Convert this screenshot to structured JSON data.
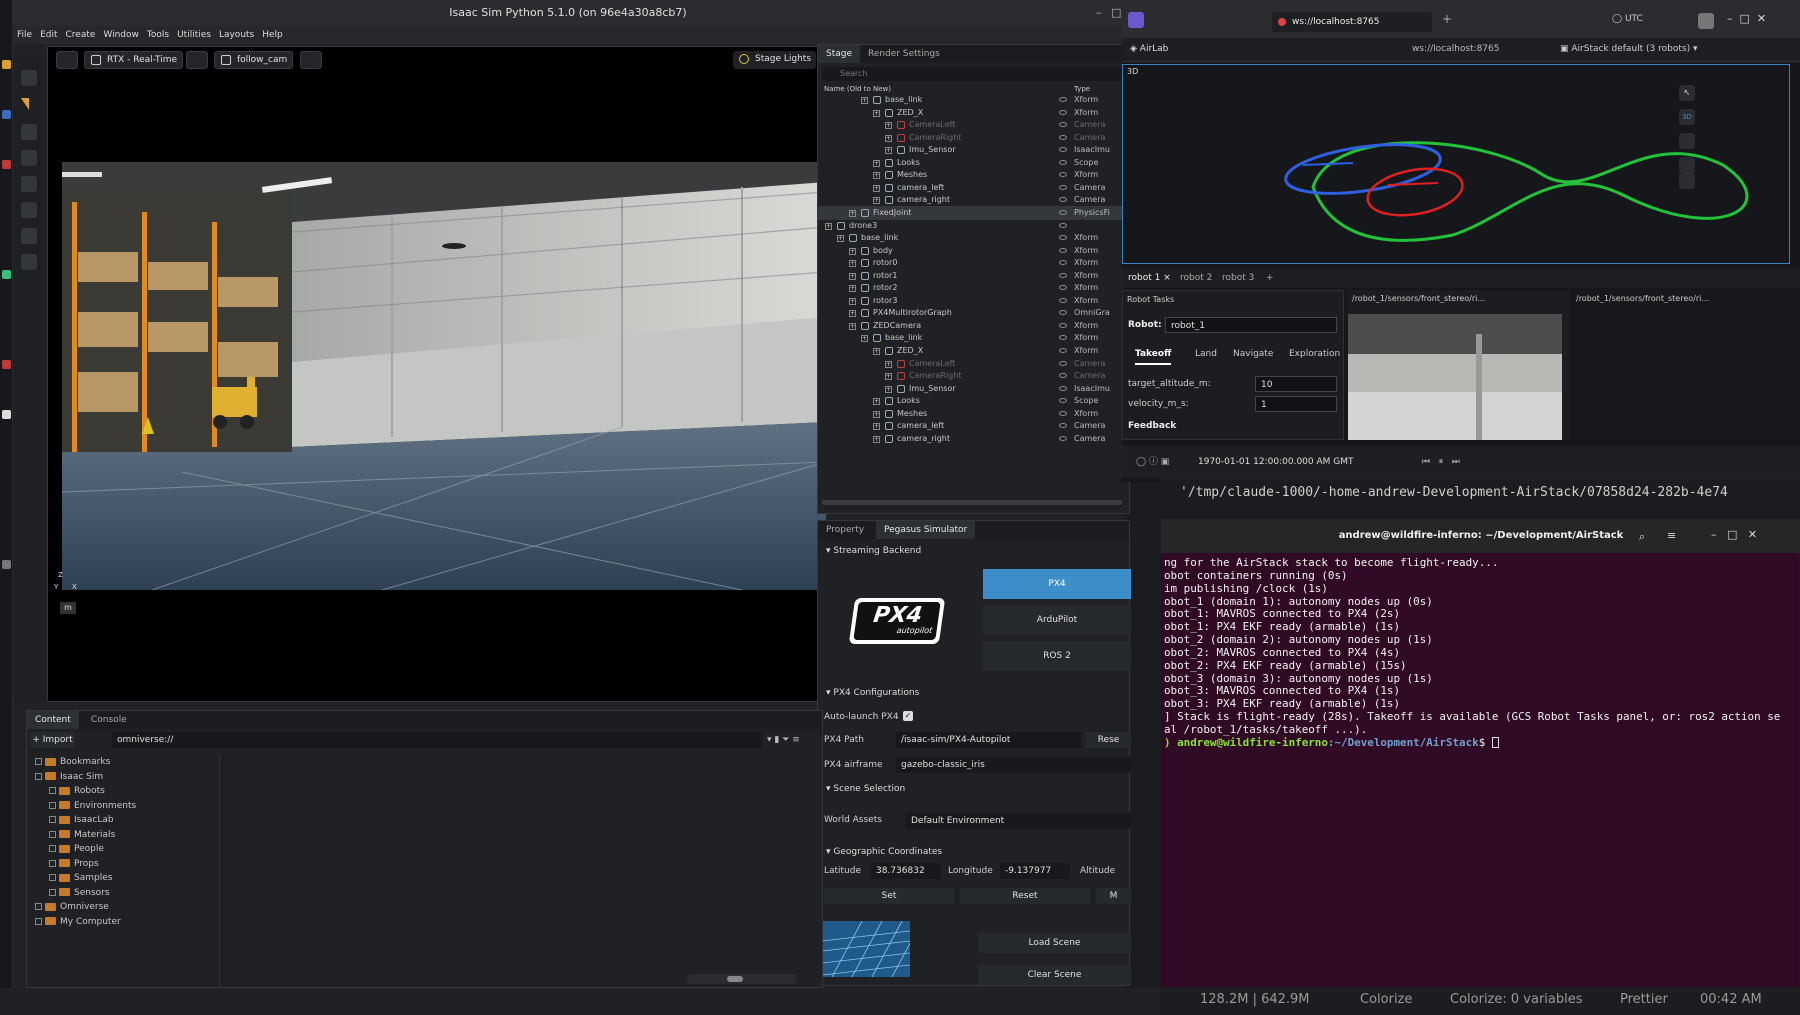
{
  "isaac": {
    "title": "Isaac Sim Python 5.1.0 (on 96e4a30a8cb7)",
    "menu": [
      "File",
      "Edit",
      "Create",
      "Window",
      "Tools",
      "Utilities",
      "Layouts",
      "Help"
    ],
    "viewport": {
      "render_mode": "RTX - Real-Time",
      "camera": "follow_cam",
      "stage_lights": "Stage Lights",
      "unit": "m",
      "axis_y": "Y",
      "axis_z": "Z",
      "axis_x": "X"
    },
    "stage_tabs": [
      "Stage",
      "Render Settings"
    ],
    "stage_search_placeholder": "Search",
    "stage_cols": {
      "name": "Name (Old to New)",
      "type": "Type"
    },
    "stage_rows": [
      {
        "name": "base_link",
        "type": "Xform",
        "d": 4
      },
      {
        "name": "ZED_X",
        "type": "Xform",
        "d": 5
      },
      {
        "name": "CameraLeft",
        "type": "Camera",
        "d": 6,
        "dim": true
      },
      {
        "name": "CameraRight",
        "type": "Camera",
        "d": 6,
        "dim": true
      },
      {
        "name": "Imu_Sensor",
        "type": "IsaacImu",
        "d": 6
      },
      {
        "name": "Looks",
        "type": "Scope",
        "d": 5
      },
      {
        "name": "Meshes",
        "type": "Xform",
        "d": 5
      },
      {
        "name": "camera_left",
        "type": "Camera",
        "d": 5
      },
      {
        "name": "camera_right",
        "type": "Camera",
        "d": 5
      },
      {
        "name": "FixedJoint",
        "type": "PhysicsFi",
        "d": 3,
        "hl": true
      },
      {
        "name": "drone3",
        "type": "",
        "d": 1
      },
      {
        "name": "base_link",
        "type": "Xform",
        "d": 2
      },
      {
        "name": "body",
        "type": "Xform",
        "d": 3
      },
      {
        "name": "rotor0",
        "type": "Xform",
        "d": 3
      },
      {
        "name": "rotor1",
        "type": "Xform",
        "d": 3
      },
      {
        "name": "rotor2",
        "type": "Xform",
        "d": 3
      },
      {
        "name": "rotor3",
        "type": "Xform",
        "d": 3
      },
      {
        "name": "PX4MultirotorGraph",
        "type": "OmniGra",
        "d": 3
      },
      {
        "name": "ZEDCamera",
        "type": "Xform",
        "d": 3
      },
      {
        "name": "base_link",
        "type": "Xform",
        "d": 4
      },
      {
        "name": "ZED_X",
        "type": "Xform",
        "d": 5
      },
      {
        "name": "CameraLeft",
        "type": "Camera",
        "d": 6,
        "dim": true
      },
      {
        "name": "CameraRight",
        "type": "Camera",
        "d": 6,
        "dim": true
      },
      {
        "name": "Imu_Sensor",
        "type": "IsaacImu",
        "d": 6
      },
      {
        "name": "Looks",
        "type": "Scope",
        "d": 5
      },
      {
        "name": "Meshes",
        "type": "Xform",
        "d": 5
      },
      {
        "name": "camera_left",
        "type": "Camera",
        "d": 5
      },
      {
        "name": "camera_right",
        "type": "Camera",
        "d": 5
      }
    ],
    "prop_tabs": [
      "Property",
      "Pegasus Simulator"
    ],
    "pegasus": {
      "streaming_backend": "Streaming Backend",
      "backends": [
        "PX4",
        "ArduPilot",
        "ROS 2"
      ],
      "px4_config": "PX4 Configurations",
      "auto_launch": "Auto-launch PX4",
      "px4_path_label": "PX4 Path",
      "px4_path": "/isaac-sim/PX4-Autopilot",
      "reset_short": "Rese",
      "airframe_label": "PX4 airframe",
      "airframe": "gazebo-classic_iris",
      "scene_selection": "Scene Selection",
      "world_assets_label": "World Assets",
      "world_assets": "Default Environment",
      "geo": "Geographic Coordinates",
      "lat_label": "Latitude",
      "lat": "38.736832",
      "lon_label": "Longitude",
      "lon": "-9.137977",
      "alt_label": "Altitude",
      "set": "Set",
      "reset": "Reset",
      "m_short": "M",
      "load_scene": "Load Scene",
      "clear_scene": "Clear Scene",
      "logo_text": "PX4",
      "logo_sub": "autopilot"
    },
    "content_tabs": [
      "Content",
      "Console"
    ],
    "import": "Import",
    "path": "omniverse://",
    "content_tree": [
      {
        "name": "Bookmarks",
        "d": 0
      },
      {
        "name": "Isaac Sim",
        "d": 0
      },
      {
        "name": "Robots",
        "d": 1
      },
      {
        "name": "Environments",
        "d": 1
      },
      {
        "name": "IsaacLab",
        "d": 1
      },
      {
        "name": "Materials",
        "d": 1
      },
      {
        "name": "People",
        "d": 1
      },
      {
        "name": "Props",
        "d": 1
      },
      {
        "name": "Samples",
        "d": 1
      },
      {
        "name": "Sensors",
        "d": 1
      },
      {
        "name": "Omniverse",
        "d": 0
      },
      {
        "name": "My Computer",
        "d": 0
      }
    ]
  },
  "foxglove": {
    "url": "ws://localhost:8765",
    "workspace": "AirLab",
    "conn": "ws://localhost:8765",
    "layout": "AirStack default (3 robots)",
    "tz": "UTC",
    "panel_3d": "3D",
    "view_mode": "3D",
    "robot_tabs": [
      "robot 1",
      "robot 2",
      "robot 3"
    ],
    "tasks": {
      "title": "Robot Tasks",
      "robot_label": "Robot:",
      "robot": "robot_1",
      "tabs": [
        "Takeoff",
        "Land",
        "Navigate",
        "Exploration"
      ],
      "alt_label": "target_altitude_m:",
      "alt": "10",
      "vel_label": "velocity_m_s:",
      "vel": "1",
      "feedback": "Feedback"
    },
    "cam1": "/robot_1/sensors/front_stereo/ri...",
    "cam2": "/robot_1/sensors/front_stereo/ri...",
    "time": "1970-01-01 12:00:00.000 AM GMT"
  },
  "behind_path": "'/tmp/claude-1000/-home-andrew-Development-AirStack/07858d24-282b-4e74",
  "terminal": {
    "title": "andrew@wildfire-inferno: ~/Development/AirStack",
    "lines": [
      "ng for the AirStack stack to become flight-ready...",
      "obot containers running (0s)",
      "im publishing /clock (1s)",
      "obot_1 (domain 1): autonomy nodes up (0s)",
      "obot_1: MAVROS connected to PX4 (2s)",
      "obot_1: PX4 EKF ready (armable) (1s)",
      "obot_2 (domain 2): autonomy nodes up (1s)",
      "obot_2: MAVROS connected to PX4 (4s)",
      "obot_2: PX4 EKF ready (armable) (15s)",
      "obot_3 (domain 3): autonomy nodes up (1s)",
      "obot_3: MAVROS connected to PX4 (1s)",
      "obot_3: PX4 EKF ready (armable) (1s)",
      "] Stack is flight-ready (28s). Takeoff is available (GCS Robot Tasks panel, or: ros2 action se",
      "al /robot_1/tasks/takeoff ...)."
    ],
    "prompt_user": ") andrew@wildfire-inferno",
    "prompt_path": ":~/Development/AirStack",
    "prompt_end": "$ "
  },
  "status": {
    "mem": "128.2M | 642.9M",
    "colorize": "Colorize",
    "colorize_vars": "Colorize: 0 variables",
    "prettier": "Prettier",
    "time": "00:42 AM"
  },
  "colors": {
    "accent": "#3d8ec9",
    "terminal_bg": "#300a24",
    "prompt_green": "#8ae234",
    "prompt_blue": "#729fcf"
  }
}
